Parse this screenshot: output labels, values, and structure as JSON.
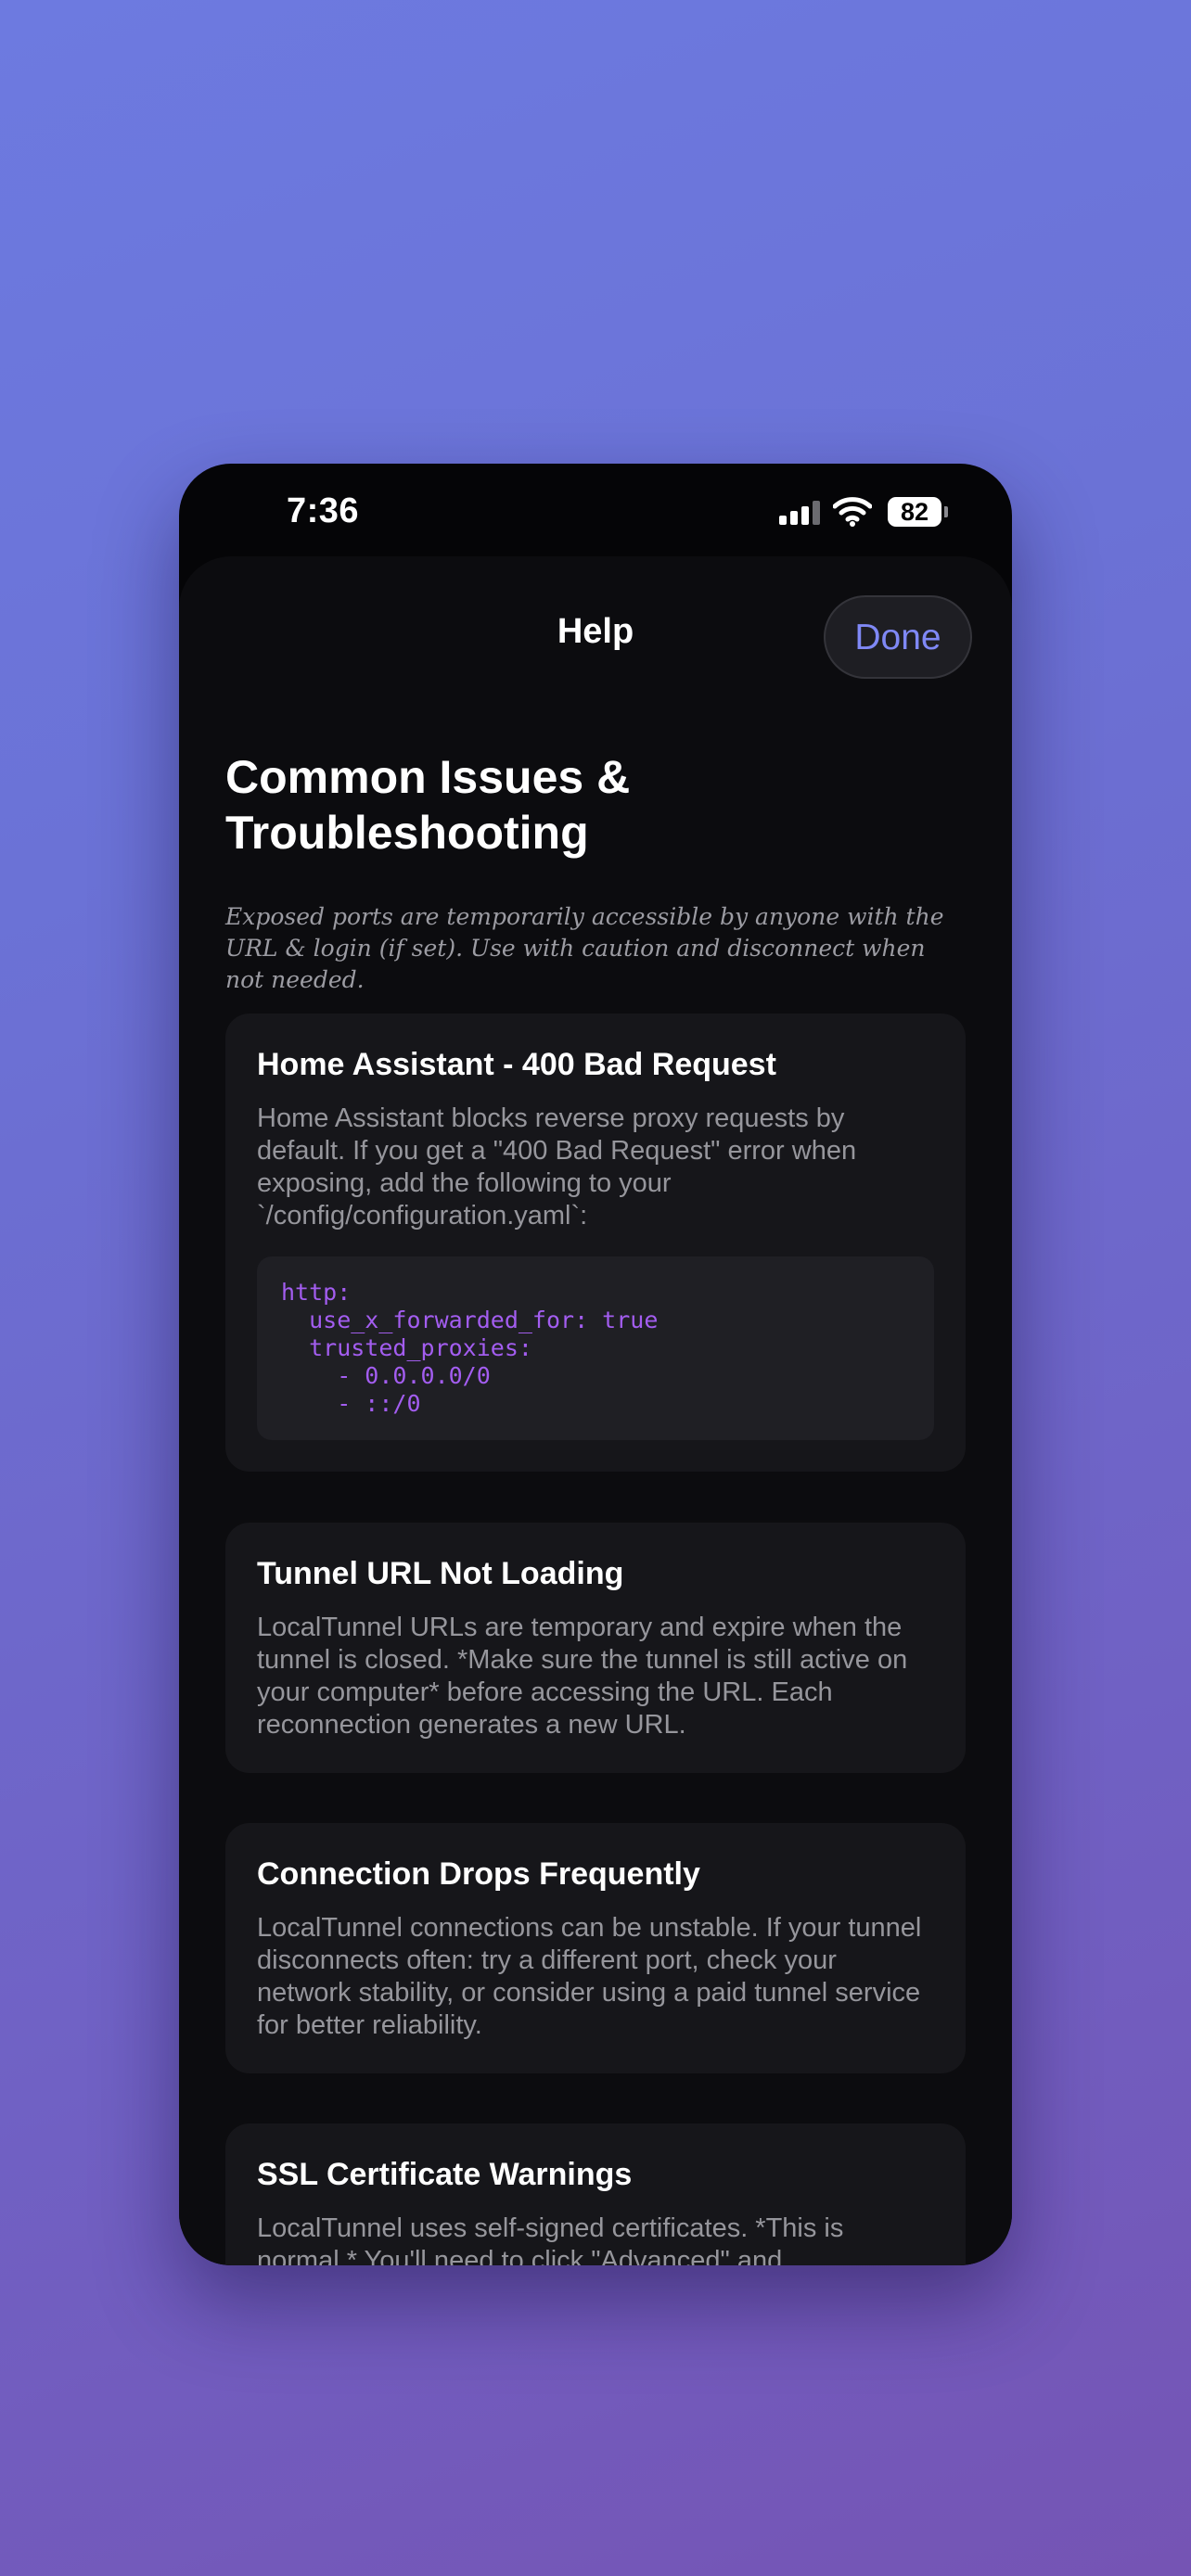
{
  "status_bar": {
    "time": "7:36",
    "battery": "82"
  },
  "nav": {
    "title": "Help",
    "done_label": "Done"
  },
  "page": {
    "heading": "Common Issues & Troubleshooting",
    "warning": "Exposed ports are temporarily accessible by anyone with the URL & login (if set). Use with caution and disconnect when not needed."
  },
  "cards": [
    {
      "title": "Home Assistant - 400 Bad Request",
      "body": "Home Assistant blocks reverse proxy requests by default. If you get a \"400 Bad Request\" error when exposing, add the following to your `/config/configuration.yaml`:",
      "code": "http:\n  use_x_forwarded_for: true\n  trusted_proxies:\n    - 0.0.0.0/0\n    - ::/0"
    },
    {
      "title": "Tunnel URL Not Loading",
      "body": "LocalTunnel URLs are temporary and expire when the tunnel is closed. *Make sure the tunnel is still active on your computer* before accessing the URL. Each reconnection generates a new URL."
    },
    {
      "title": "Connection Drops Frequently",
      "body": "LocalTunnel connections can be unstable. If your tunnel disconnects often: try a different port, check your network stability, or consider using a paid tunnel service for better reliability."
    },
    {
      "title": "SSL Certificate Warnings",
      "body": "LocalTunnel uses self-signed certificates. *This is normal.* You'll need to click \"Advanced\" and"
    }
  ],
  "colors": {
    "accent": "#7f88f5",
    "code": "#a35df0",
    "sheet": "#0c0c0f",
    "card": "#16161a"
  }
}
